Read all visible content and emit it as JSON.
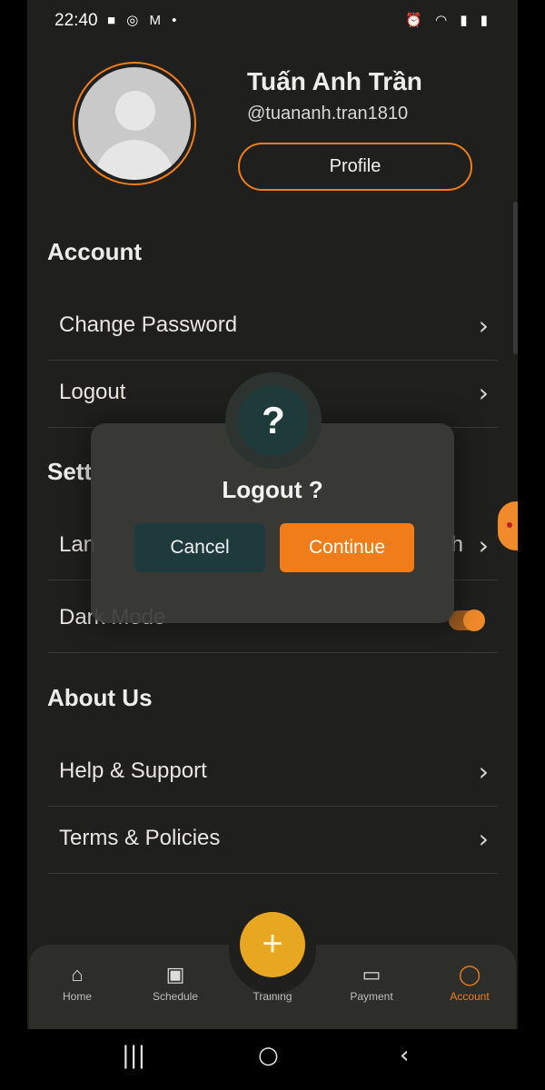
{
  "status_bar": {
    "time": "22:40",
    "left_icons": "■ ◎ M •",
    "right_icons": "⏰ ◠ ▮ ▮"
  },
  "profile": {
    "name": "Tuấn Anh Trần",
    "handle": "@tuananh.tran1810",
    "button_label": "Profile"
  },
  "account": {
    "title": "Account",
    "items": [
      {
        "label": "Change Password",
        "icon": "chevron-right-icon"
      },
      {
        "label": "Logout",
        "icon": "chevron-right-icon"
      }
    ]
  },
  "settings": {
    "title_visible": "Sett",
    "language_label_visible": "Lan",
    "language_value_visible": "h",
    "dark_mode_label": "Dark Mode",
    "dark_mode_on": true
  },
  "about": {
    "title": "About Us",
    "items": [
      {
        "label": "Help & Support",
        "icon": "chevron-right-icon"
      },
      {
        "label": "Terms & Policies",
        "icon": "chevron-right-icon"
      }
    ]
  },
  "dialog": {
    "icon": "?",
    "title": "Logout ?",
    "cancel_label": "Cancel",
    "continue_label": "Continue"
  },
  "tabbar": {
    "fab_icon": "+",
    "tabs": [
      {
        "label": "Home",
        "icon": "home-icon",
        "glyph": "⌂",
        "active": false
      },
      {
        "label": "Schedule",
        "icon": "calendar-icon",
        "glyph": "▣",
        "active": false
      },
      {
        "label": "Training",
        "icon": "plus-icon",
        "glyph": "",
        "active": false
      },
      {
        "label": "Payment",
        "icon": "card-icon",
        "glyph": "▭",
        "active": false
      },
      {
        "label": "Account",
        "icon": "person-icon",
        "glyph": "◯",
        "active": true
      }
    ]
  },
  "system_nav": {
    "recents": "|||",
    "home": "○",
    "back": "‹"
  },
  "colors": {
    "accent": "#f07d1a",
    "background": "#1f1f1d",
    "fab": "#e7a720",
    "dialog_cancel": "#1f3a3c"
  }
}
